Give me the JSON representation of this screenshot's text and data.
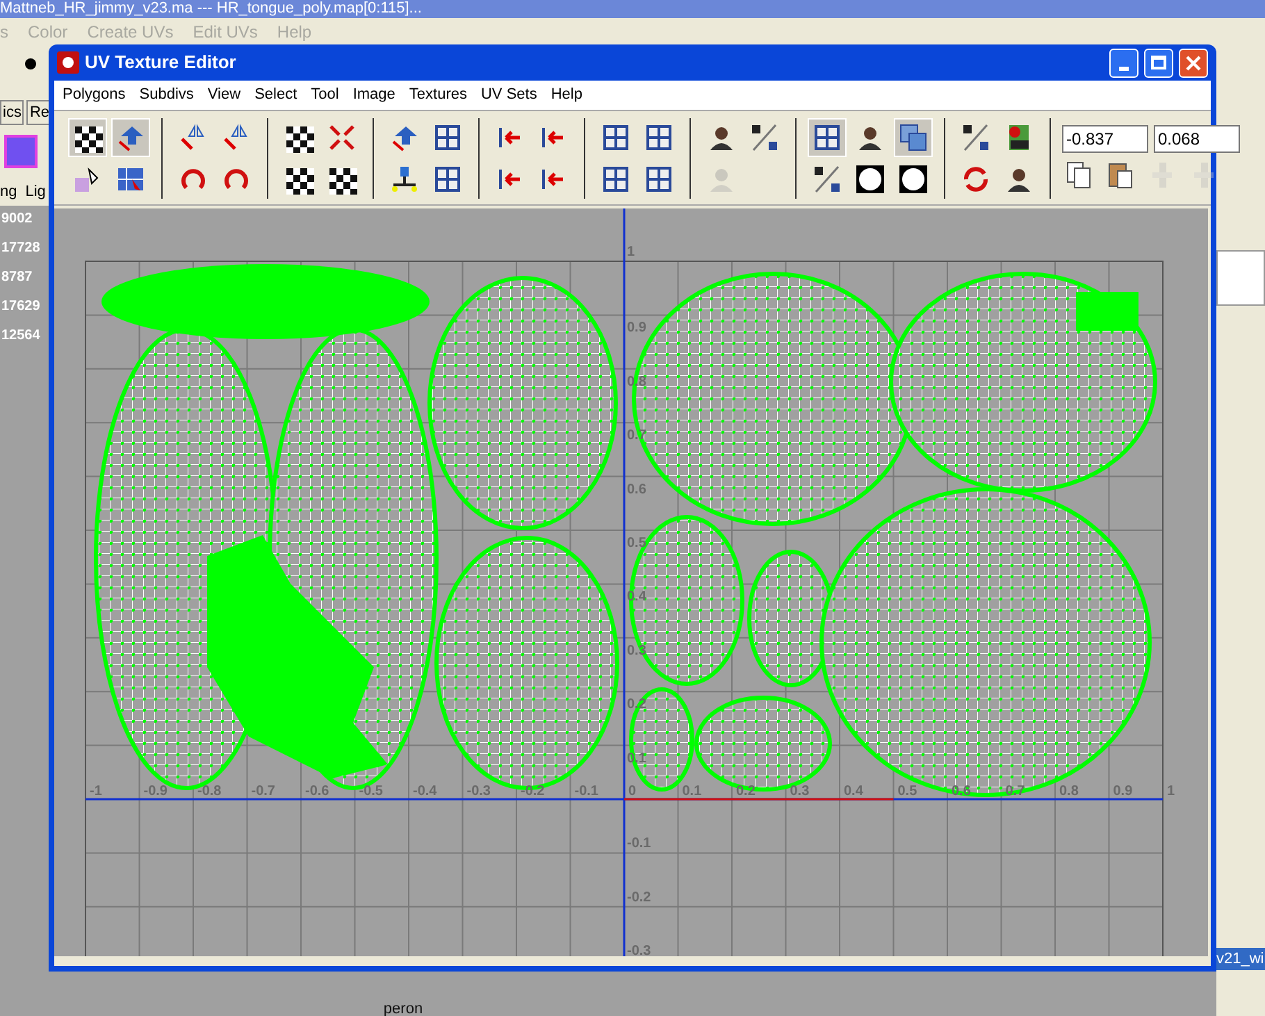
{
  "background": {
    "title": "Mattneb_HR_jimmy_v23.ma  ---  HR_tongue_poly.map[0:115]...",
    "menu": [
      "s",
      "Color",
      "Create UVs",
      "Edit UVs",
      "Help"
    ],
    "tabs": [
      "ics",
      "Re"
    ],
    "panel_headers": [
      "ng",
      "Lig"
    ],
    "counts": [
      "9002",
      "17728",
      "8787",
      "17629",
      "12564"
    ],
    "list_item": {
      "label": "v21_wi",
      "selected": true
    },
    "viewport_label": "peron"
  },
  "window": {
    "title": "UV Texture Editor",
    "menu": [
      "Polygons",
      "Subdivs",
      "View",
      "Select",
      "Tool",
      "Image",
      "Textures",
      "UV Sets",
      "Help"
    ],
    "toolbar": [
      {
        "top": [
          {
            "kind": "checker",
            "pressed": true
          },
          {
            "kind": "move",
            "pressed": true
          }
        ],
        "bottom": [
          {
            "kind": "pointer",
            "pressed": false
          },
          {
            "kind": "select",
            "pressed": false
          }
        ]
      },
      {
        "top": [
          {
            "kind": "flip",
            "pressed": false
          },
          {
            "kind": "flip",
            "pressed": false
          }
        ],
        "bottom": [
          {
            "kind": "rotate",
            "pressed": false
          },
          {
            "kind": "rotate",
            "pressed": false
          }
        ]
      },
      {
        "top": [
          {
            "kind": "checker",
            "pressed": false
          },
          {
            "kind": "sew",
            "pressed": false
          }
        ],
        "bottom": [
          {
            "kind": "checker",
            "pressed": false
          },
          {
            "kind": "checker",
            "pressed": false
          }
        ]
      },
      {
        "top": [
          {
            "kind": "move",
            "pressed": false
          },
          {
            "kind": "grid",
            "pressed": false
          }
        ],
        "bottom": [
          {
            "kind": "layout",
            "pressed": false
          },
          {
            "kind": "grid",
            "pressed": false
          }
        ]
      },
      {
        "top": [
          {
            "kind": "align",
            "pressed": false
          },
          {
            "kind": "align",
            "pressed": false
          }
        ],
        "bottom": [
          {
            "kind": "align",
            "pressed": false
          },
          {
            "kind": "align",
            "pressed": false
          }
        ]
      },
      {
        "top": [
          {
            "kind": "grid",
            "pressed": false
          },
          {
            "kind": "grid",
            "pressed": false
          }
        ],
        "bottom": [
          {
            "kind": "grid",
            "pressed": false
          },
          {
            "kind": "grid",
            "pressed": false
          }
        ]
      },
      {
        "top": [
          {
            "kind": "person",
            "pressed": false
          },
          {
            "kind": "diagonal",
            "pressed": false
          }
        ],
        "bottom": [
          {
            "kind": "person",
            "pressed": false,
            "disabled": true
          }
        ]
      },
      {
        "top": [
          {
            "kind": "grid",
            "pressed": true
          },
          {
            "kind": "person",
            "pressed": false
          },
          {
            "kind": "overlap",
            "pressed": true
          }
        ],
        "bottom": [
          {
            "kind": "diagonal",
            "pressed": false
          },
          {
            "kind": "ball",
            "pressed": false
          },
          {
            "kind": "ball",
            "pressed": false
          }
        ]
      },
      {
        "top": [
          {
            "kind": "diagonal",
            "pressed": false
          },
          {
            "kind": "psd",
            "pressed": false
          }
        ],
        "bottom": [
          {
            "kind": "refresh",
            "pressed": false
          },
          {
            "kind": "person",
            "pressed": false
          }
        ]
      }
    ],
    "fields": [
      "-0.837",
      "0.068"
    ],
    "tools": [
      {
        "kind": "copy",
        "disabled": false
      },
      {
        "kind": "paste",
        "disabled": false
      },
      {
        "kind": "bar",
        "disabled": true
      },
      {
        "kind": "bar",
        "disabled": true
      }
    ],
    "u_labels": [
      "-1",
      "-0.9",
      "-0.8",
      "-0.7",
      "-0.6",
      "-0.5",
      "-0.4",
      "-0.3",
      "-0.2",
      "-0.1",
      "0",
      "0.1",
      "0.2",
      "0.3",
      "0.4",
      "0.5",
      "0.6",
      "0.7",
      "0.8",
      "0.9",
      "1"
    ],
    "v_labels": [
      "1",
      "0.9",
      "0.8",
      "0.7",
      "0.6",
      "0.5",
      "0.4",
      "0.3",
      "0.2",
      "0.1",
      "-0.1",
      "-0.2",
      "-0.3"
    ]
  }
}
